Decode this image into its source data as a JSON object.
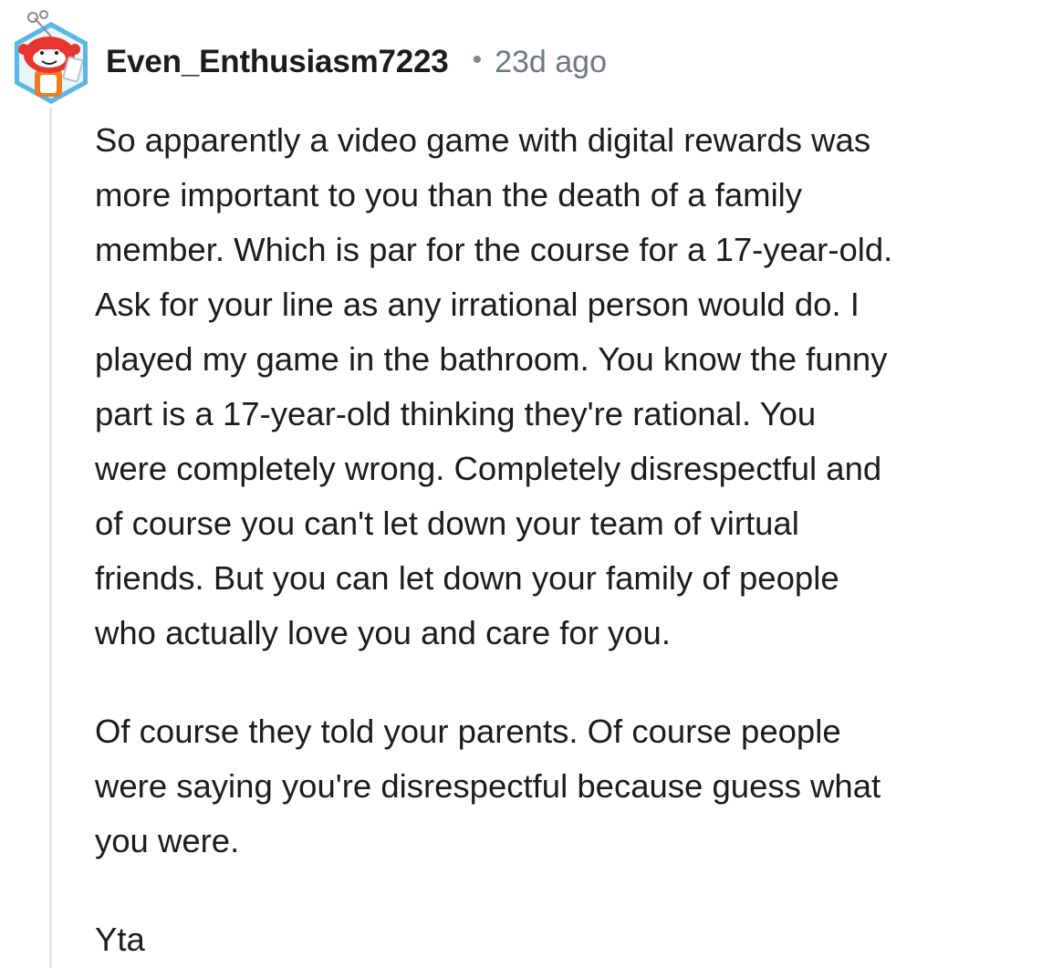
{
  "comment": {
    "author": "Even_Enthusiasm7223",
    "separator": "•",
    "timestamp": "23d ago",
    "paragraphs": [
      [
        "So apparently a video game with digital rewards was",
        "more important to you than the death of a family",
        "member. Which is par for the course for a 17-year-old.",
        "Ask for your line as any irrational person would do. I",
        "played my game in the bathroom. You know the funny",
        "part is a 17-year-old thinking they're rational. You",
        "were completely wrong. Completely disrespectful and",
        "of course you can't let down your team of virtual",
        "friends. But you can let down your family of people",
        "who actually love you and care for you."
      ],
      [
        "Of course they told your parents. Of course people",
        "were saying you're disrespectful because guess what",
        "you were."
      ],
      [
        "Yta"
      ]
    ]
  },
  "avatar": {
    "icon": "reddit-snoo-avatar-icon",
    "colors": {
      "frame": "#5bb8e6",
      "body": "#e8362e",
      "accent": "#f07c1c",
      "skin": "#ffffff"
    }
  }
}
